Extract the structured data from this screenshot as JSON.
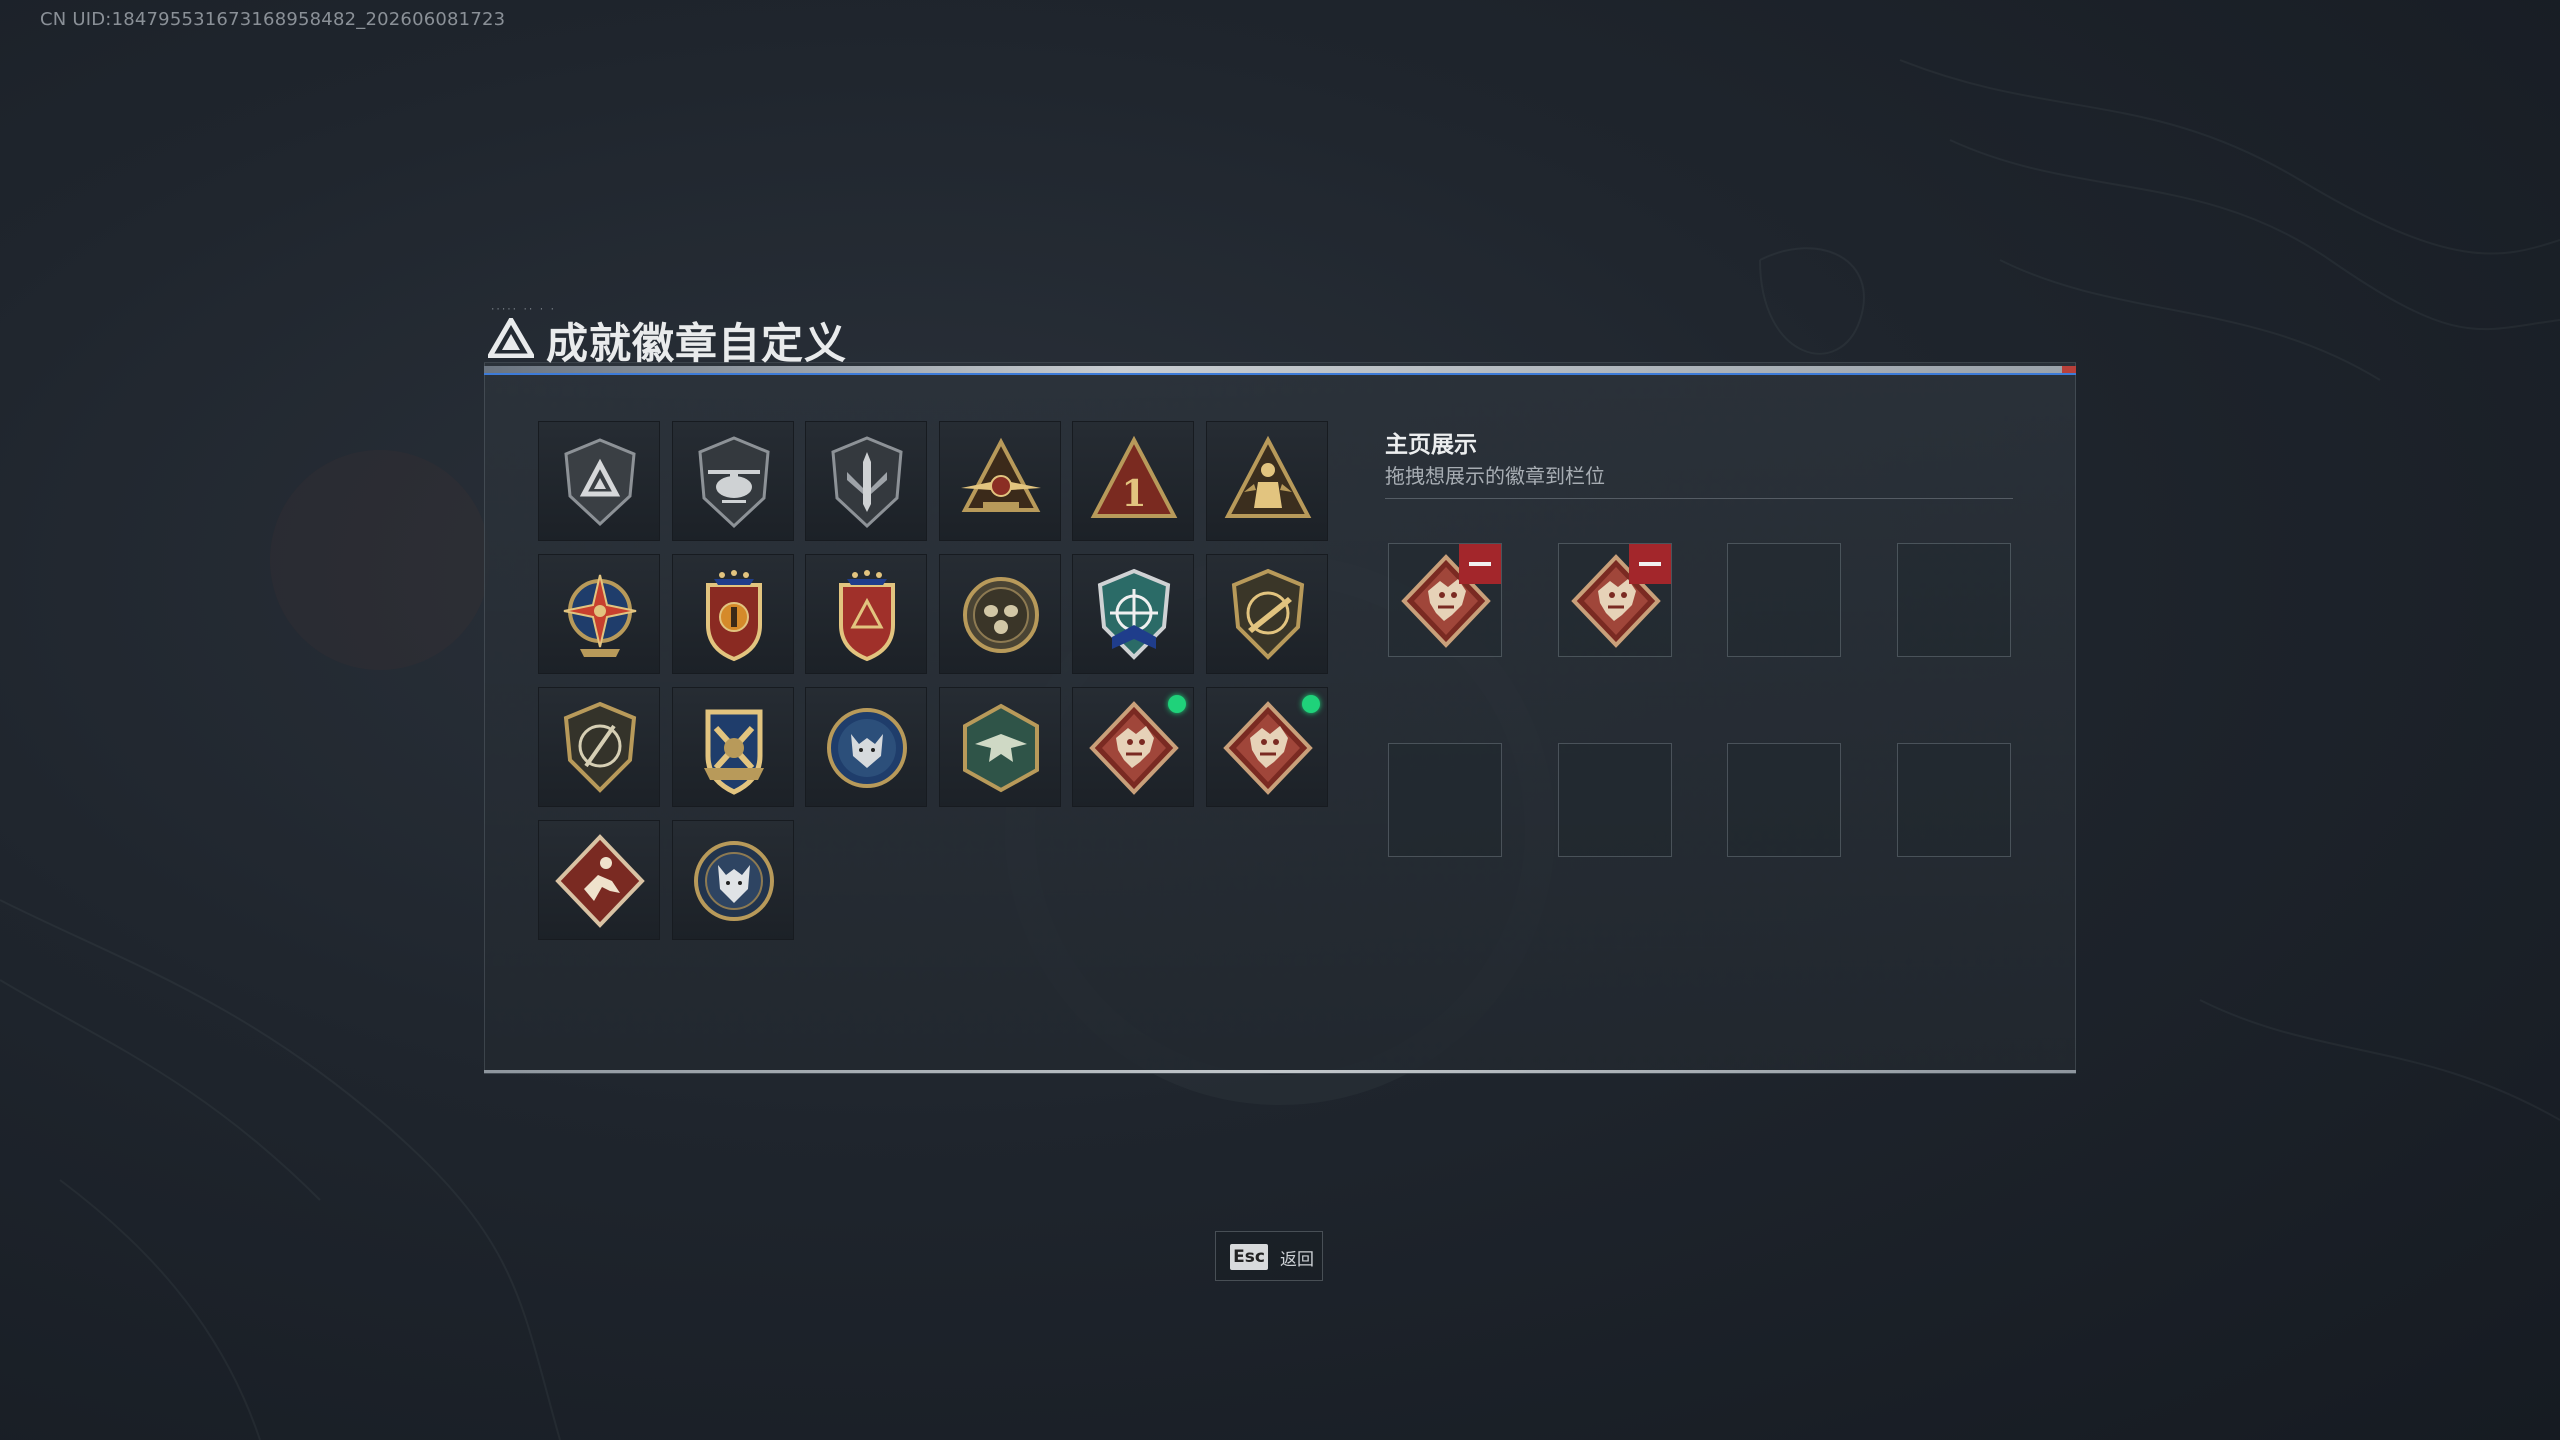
{
  "uid_text": "CN UID:184795531673168958482_202606081723",
  "title": "成就徽章自定义",
  "colors": {
    "accent_blue": "#3d7bd8",
    "remove_red": "#a3262b",
    "active_dot_green": "#1fd27a"
  },
  "badges": [
    {
      "icon": "delta-shield-badge-icon",
      "equipped": false
    },
    {
      "icon": "helicopter-badge-icon",
      "equipped": false
    },
    {
      "icon": "sword-shield-badge-icon",
      "equipped": false
    },
    {
      "icon": "winged-triangle-badge-icon",
      "equipped": false
    },
    {
      "icon": "number-one-triangle-badge-icon",
      "equipped": false
    },
    {
      "icon": "soldier-triangle-badge-icon",
      "equipped": false
    },
    {
      "icon": "star-compass-badge-icon",
      "equipped": false
    },
    {
      "icon": "crest-stars-badge-icon",
      "equipped": false
    },
    {
      "icon": "red-crest-badge-icon",
      "equipped": false
    },
    {
      "icon": "gasmask-medal-badge-icon",
      "equipped": false
    },
    {
      "icon": "crosshair-shield-badge-icon",
      "equipped": false
    },
    {
      "icon": "rifle-shield-badge-icon",
      "equipped": false
    },
    {
      "icon": "sniper-shield-badge-icon",
      "equipped": false
    },
    {
      "icon": "gold-crossed-shield-badge-icon",
      "equipped": false
    },
    {
      "icon": "wolf-circle-badge-icon",
      "equipped": false
    },
    {
      "icon": "bird-hexagon-badge-icon",
      "equipped": false
    },
    {
      "icon": "dragon-diamond-badge-icon",
      "equipped": true
    },
    {
      "icon": "dragon-diamond-badge-icon",
      "equipped": true
    },
    {
      "icon": "runner-diamond-badge-icon",
      "equipped": false
    },
    {
      "icon": "wolf-medal-badge-icon",
      "equipped": false
    }
  ],
  "showcase": {
    "title": "主页展示",
    "subtitle": "拖拽想展示的徽章到栏位",
    "slots": [
      {
        "icon": "dragon-diamond-badge-icon",
        "filled": true
      },
      {
        "icon": "dragon-diamond-badge-icon",
        "filled": true
      },
      {
        "filled": false
      },
      {
        "filled": false
      },
      {
        "filled": false
      },
      {
        "filled": false
      },
      {
        "filled": false
      },
      {
        "filled": false
      }
    ]
  },
  "footer": {
    "esc_key": "Esc",
    "back_label": "返回"
  }
}
